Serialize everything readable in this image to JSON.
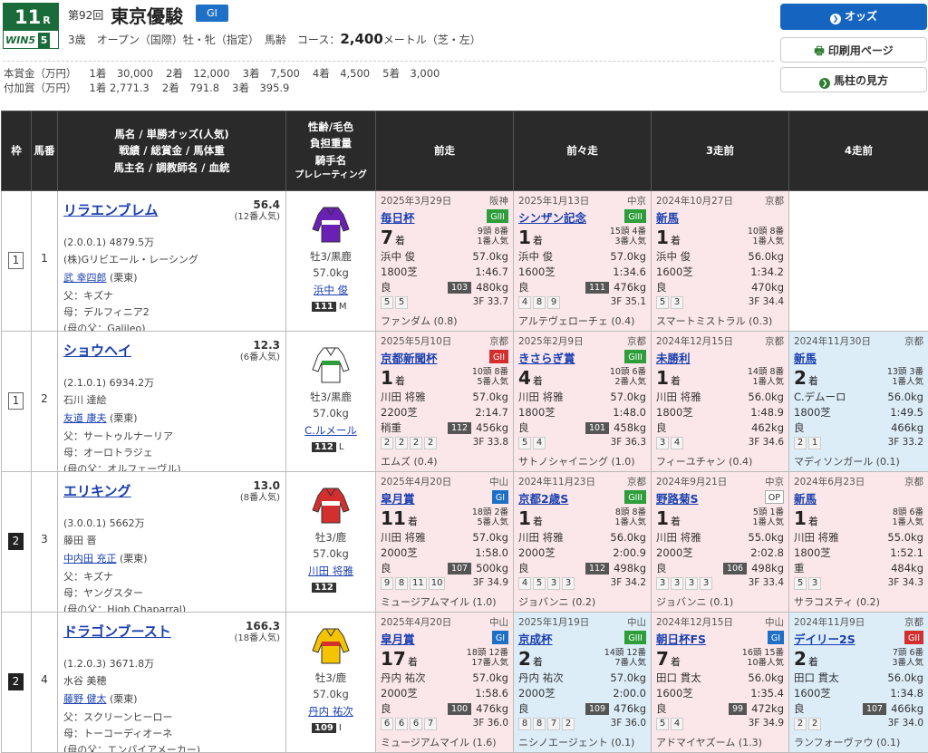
{
  "race": {
    "no": "11",
    "r": "R",
    "win5_label": "WIN5",
    "win5_no": "5",
    "kai": "第92回",
    "name": "東京優駿",
    "grade": "GI",
    "conditions": "3歳　オープン（国際）牡・牝（指定）　馬齢　コース：",
    "distance": "2,400",
    "course": "メートル（芝・左）"
  },
  "prize": {
    "honsho_label": "本賞金（万円）",
    "honsho": [
      "1着　30,000",
      "2着　12,000",
      "3着　7,500",
      "4着　4,500",
      "5着　3,000"
    ],
    "fuka_label": "付加賞（万円）",
    "fuka": [
      "1着 2,771.3",
      "2着　791.8",
      "3着　395.9"
    ]
  },
  "buttons": {
    "odds": "オッズ",
    "print": "印刷用ページ",
    "guide": "馬柱の見方"
  },
  "table": {
    "h_waku": "枠",
    "h_uma": "馬番",
    "h_horse": [
      "馬名 / 単勝オッズ(人気)",
      "戦績 / 総賞金 / 馬体重",
      "馬主名 / 調教師名 / 血統"
    ],
    "h_jockey": [
      "性齢/毛色",
      "負担重量",
      "騎手名",
      "プレレーティング"
    ],
    "h_prev": [
      "前走",
      "前々走",
      "3走前",
      "4走前"
    ]
  },
  "colors": {
    "accent": "#1565c0",
    "header_bg": "#2a2a2a",
    "pink": "#fbe7e9",
    "blue": "#dcedf8",
    "green": "#1a6b3a"
  },
  "horses": [
    {
      "waku": "1",
      "uma": "1",
      "name": "リラエンブレム",
      "odds": "56.4",
      "pop": "(12番人気)",
      "record": "(2.0.0.1)",
      "money": "4879.5万",
      "owner": "(株)Gリビエール・レーシング",
      "trainer": "武 幸四郎",
      "loc": "(栗東)",
      "sire": "父：キズナ",
      "dam": "母：デルフィニア2",
      "bms": "(母の父：Galileo)",
      "sex": "牡3/黒鹿",
      "weight": "57.0kg",
      "jockey": "浜中 俊",
      "rating": "111",
      "rmark": "M",
      "silk": [
        "#6a1fb5",
        "#fff"
      ],
      "past": [
        {
          "bg": "pink",
          "date": "2025年3月29日",
          "place": "阪神",
          "race": "毎日杯",
          "grade": "GIII",
          "gc": "G3",
          "rank": "7",
          "heads": "9頭 8番",
          "pop": "1番人気",
          "jockey": "浜中 俊",
          "wt": "57.0kg",
          "dist": "1800芝",
          "time": "1:46.7",
          "cond": "良",
          "rt": "103",
          "bw": "480kg",
          "pos": [
            "5",
            "5"
          ],
          "f3": "3F 33.7",
          "winner": "ファンダム (0.8)"
        },
        {
          "bg": "pink",
          "date": "2025年1月13日",
          "place": "中京",
          "race": "シンザン記念",
          "grade": "GIII",
          "gc": "G3",
          "rank": "1",
          "heads": "15頭 4番",
          "pop": "3番人気",
          "jockey": "浜中 俊",
          "wt": "57.0kg",
          "dist": "1600芝",
          "time": "1:34.6",
          "cond": "良",
          "rt": "111",
          "bw": "476kg",
          "pos": [
            "4",
            "8",
            "9"
          ],
          "f3": "3F 35.1",
          "winner": "アルテヴェローチェ (0.4)"
        },
        {
          "bg": "pink",
          "date": "2024年10月27日",
          "place": "京都",
          "race": "新馬",
          "grade": "",
          "gc": "",
          "rank": "1",
          "heads": "10頭 8番",
          "pop": "1番人気",
          "jockey": "浜中 俊",
          "wt": "56.0kg",
          "dist": "1600芝",
          "time": "1:34.2",
          "cond": "良",
          "rt": "",
          "bw": "470kg",
          "pos": [
            "5",
            "3"
          ],
          "f3": "3F 34.4",
          "winner": "スマートミストラル (0.3)"
        },
        null
      ]
    },
    {
      "waku": "1",
      "uma": "2",
      "name": "ショウヘイ",
      "odds": "12.3",
      "pop": "(6番人気)",
      "record": "(2.1.0.1)",
      "money": "6934.2万",
      "owner": "石川 達絵",
      "trainer": "友道 康夫",
      "loc": "(栗東)",
      "sire": "父：サートゥルナーリア",
      "dam": "母：オーロトラジェ",
      "bms": "(母の父：オルフェーヴル)",
      "sex": "牡3/黒鹿",
      "weight": "57.0kg",
      "jockey": "C.ルメール",
      "rating": "112",
      "rmark": "L",
      "silk": [
        "#fff",
        "#2e9e3a"
      ],
      "past": [
        {
          "bg": "pink",
          "date": "2025年5月10日",
          "place": "京都",
          "race": "京都新聞杯",
          "grade": "GII",
          "gc": "G2",
          "rank": "1",
          "heads": "10頭 8番",
          "pop": "5番人気",
          "jockey": "川田 将雅",
          "wt": "57.0kg",
          "dist": "2200芝",
          "time": "2:14.7",
          "cond": "稍重",
          "rt": "112",
          "bw": "456kg",
          "pos": [
            "2",
            "2",
            "2",
            "2"
          ],
          "f3": "3F 33.8",
          "winner": "エムズ (0.4)"
        },
        {
          "bg": "pink",
          "date": "2025年2月9日",
          "place": "京都",
          "race": "きさらぎ賞",
          "grade": "GIII",
          "gc": "G3",
          "rank": "4",
          "heads": "10頭 6番",
          "pop": "2番人気",
          "jockey": "川田 将雅",
          "wt": "57.0kg",
          "dist": "1800芝",
          "time": "1:48.0",
          "cond": "良",
          "rt": "101",
          "bw": "458kg",
          "pos": [
            "5",
            "4"
          ],
          "f3": "3F 36.3",
          "winner": "サトノシャイニング (1.0)"
        },
        {
          "bg": "pink",
          "date": "2024年12月15日",
          "place": "京都",
          "race": "未勝利",
          "grade": "",
          "gc": "",
          "rank": "1",
          "heads": "14頭 8番",
          "pop": "1番人気",
          "jockey": "川田 将雅",
          "wt": "56.0kg",
          "dist": "1800芝",
          "time": "1:48.9",
          "cond": "良",
          "rt": "",
          "bw": "462kg",
          "pos": [
            "3",
            "4"
          ],
          "f3": "3F 34.6",
          "winner": "フィーユチャン (0.4)"
        },
        {
          "bg": "blue",
          "date": "2024年11月30日",
          "place": "京都",
          "race": "新馬",
          "grade": "",
          "gc": "",
          "rank": "2",
          "heads": "13頭 3番",
          "pop": "1番人気",
          "jockey": "C.デムーロ",
          "wt": "56.0kg",
          "dist": "1800芝",
          "time": "1:49.5",
          "cond": "良",
          "rt": "",
          "bw": "466kg",
          "pos": [
            "2",
            "1"
          ],
          "f3": "3F 33.2",
          "winner": "マディソンガール (0.1)"
        }
      ]
    },
    {
      "waku": "2",
      "uma": "3",
      "name": "エリキング",
      "odds": "13.0",
      "pop": "(8番人気)",
      "record": "(3.0.0.1)",
      "money": "5662万",
      "owner": "藤田 晋",
      "trainer": "中内田 充正",
      "loc": "(栗東)",
      "sire": "父：キズナ",
      "dam": "母：ヤングスター",
      "bms": "(母の父：High Chaparral)",
      "sex": "牡3/鹿",
      "weight": "57.0kg",
      "jockey": "川田 将雅",
      "rating": "112",
      "rmark": "",
      "silk": [
        "#d32f2f",
        "#fff"
      ],
      "past": [
        {
          "bg": "pink",
          "date": "2025年4月20日",
          "place": "中山",
          "race": "皐月賞",
          "grade": "GI",
          "gc": "G1",
          "rank": "11",
          "heads": "18頭 2番",
          "pop": "5番人気",
          "jockey": "川田 将雅",
          "wt": "57.0kg",
          "dist": "2000芝",
          "time": "1:58.0",
          "cond": "良",
          "rt": "107",
          "bw": "500kg",
          "pos": [
            "9",
            "8",
            "11",
            "10"
          ],
          "f3": "3F 34.9",
          "winner": "ミュージアムマイル (1.0)"
        },
        {
          "bg": "pink",
          "date": "2024年11月23日",
          "place": "京都",
          "race": "京都2歳S",
          "grade": "GIII",
          "gc": "G3",
          "rank": "1",
          "heads": "8頭 8番",
          "pop": "1番人気",
          "jockey": "川田 将雅",
          "wt": "56.0kg",
          "dist": "2000芝",
          "time": "2:00.9",
          "cond": "良",
          "rt": "112",
          "bw": "498kg",
          "pos": [
            "4",
            "5",
            "3",
            "3"
          ],
          "f3": "3F 34.2",
          "winner": "ジョバンニ (0.2)"
        },
        {
          "bg": "pink",
          "date": "2024年9月21日",
          "place": "中京",
          "race": "野路菊S",
          "grade": "OP",
          "gc": "OP",
          "rank": "1",
          "heads": "5頭 1番",
          "pop": "1番人気",
          "jockey": "川田 将雅",
          "wt": "55.0kg",
          "dist": "2000芝",
          "time": "2:02.8",
          "cond": "良",
          "rt": "106",
          "bw": "498kg",
          "pos": [
            "3",
            "3",
            "3",
            "3"
          ],
          "f3": "3F 33.4",
          "winner": "ジョバンニ (0.1)"
        },
        {
          "bg": "pink",
          "date": "2024年6月23日",
          "place": "京都",
          "race": "新馬",
          "grade": "",
          "gc": "",
          "rank": "1",
          "heads": "8頭 6番",
          "pop": "1番人気",
          "jockey": "川田 将雅",
          "wt": "55.0kg",
          "dist": "1800芝",
          "time": "1:52.1",
          "cond": "重",
          "rt": "",
          "bw": "484kg",
          "pos": [
            "5",
            "3"
          ],
          "f3": "3F 34.3",
          "winner": "サラコスティ (0.2)"
        }
      ]
    },
    {
      "waku": "2",
      "uma": "4",
      "name": "ドラゴンブースト",
      "odds": "166.3",
      "pop": "(18番人気)",
      "record": "(1.2.0.3)",
      "money": "3671.8万",
      "owner": "水谷 美穂",
      "trainer": "藤野 健太",
      "loc": "(栗東)",
      "sire": "父：スクリーンヒーロー",
      "dam": "母：トーコーディオーネ",
      "bms": "(母の父：エンパイアメーカー)",
      "sex": "牡3/鹿",
      "weight": "57.0kg",
      "jockey": "丹内 祐次",
      "rating": "109",
      "rmark": "I",
      "silk": [
        "#f5c400",
        "#d32f2f"
      ],
      "past": [
        {
          "bg": "pink",
          "date": "2025年4月20日",
          "place": "中山",
          "race": "皐月賞",
          "grade": "GI",
          "gc": "G1",
          "rank": "17",
          "heads": "18頭 12番",
          "pop": "17番人気",
          "jockey": "丹内 祐次",
          "wt": "57.0kg",
          "dist": "2000芝",
          "time": "1:58.6",
          "cond": "良",
          "rt": "100",
          "bw": "476kg",
          "pos": [
            "6",
            "6",
            "6",
            "7"
          ],
          "f3": "3F 36.0",
          "winner": "ミュージアムマイル (1.6)"
        },
        {
          "bg": "blue",
          "date": "2025年1月19日",
          "place": "中山",
          "race": "京成杯",
          "grade": "GIII",
          "gc": "G3",
          "rank": "2",
          "heads": "14頭 12番",
          "pop": "7番人気",
          "jockey": "丹内 祐次",
          "wt": "57.0kg",
          "dist": "2000芝",
          "time": "2:00.0",
          "cond": "良",
          "rt": "109",
          "bw": "476kg",
          "pos": [
            "8",
            "8",
            "7",
            "2"
          ],
          "f3": "3F 36.0",
          "winner": "ニシノエージェント (0.1)"
        },
        {
          "bg": "pink",
          "date": "2024年12月15日",
          "place": "中山",
          "race": "朝日杯FS",
          "grade": "GI",
          "gc": "G1",
          "rank": "7",
          "heads": "16頭 15番",
          "pop": "10番人気",
          "jockey": "田口 貫太",
          "wt": "56.0kg",
          "dist": "1600芝",
          "time": "1:35.4",
          "cond": "良",
          "rt": "99",
          "bw": "472kg",
          "pos": [
            "5",
            "4"
          ],
          "f3": "3F 34.9",
          "winner": "アドマイヤズーム (1.3)"
        },
        {
          "bg": "blue",
          "date": "2024年11月9日",
          "place": "京都",
          "race": "デイリー2S",
          "grade": "GII",
          "gc": "G2",
          "rank": "2",
          "heads": "7頭 6番",
          "pop": "3番人気",
          "jockey": "田口 貫太",
          "wt": "56.0kg",
          "dist": "1600芝",
          "time": "1:34.8",
          "cond": "良",
          "rt": "107",
          "bw": "466kg",
          "pos": [
            "2",
            "2"
          ],
          "f3": "3F 34.0",
          "winner": "ランフォーヴァウ (0.1)"
        }
      ]
    }
  ]
}
